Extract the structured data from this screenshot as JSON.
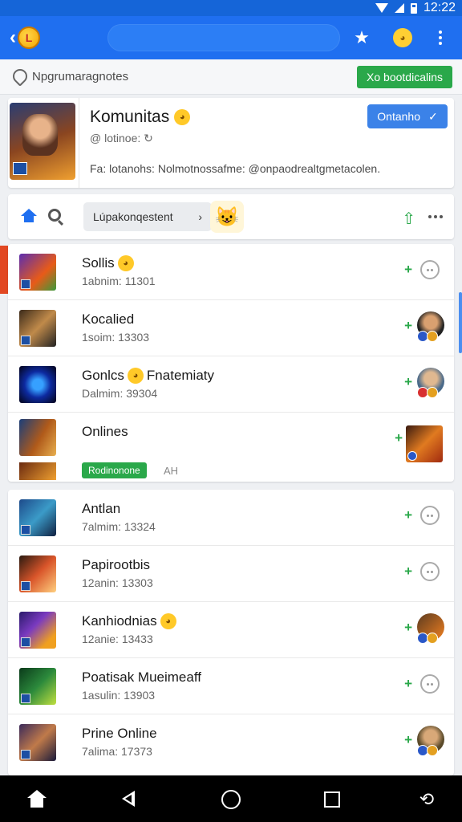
{
  "status_bar": {
    "time": "12:22"
  },
  "appbar": {
    "logo_text": "L"
  },
  "subbar": {
    "text": "Npgrumaragnotes",
    "button": "Xo bootdicalins"
  },
  "profile": {
    "name": "Komunitas",
    "handle": "@ lotinoe:",
    "bio": "Fa: lotanohs: Nolmotnossafme: @onpaodrealtgmetacolen.",
    "status_button": "Ontanho"
  },
  "nav": {
    "breadcrumb": "Lúpakonqestent"
  },
  "list1": [
    {
      "name": "Sollis",
      "sub": "1abnim: 11301",
      "emoji": true,
      "action": "chat"
    },
    {
      "name": "Kocalied",
      "sub": "1soim: 13303",
      "emoji": false,
      "action": "avatar"
    },
    {
      "name": "Gonlcs",
      "name_suffix": "Fnatemiaty",
      "sub": "Dalmim: 39304",
      "emoji": true,
      "action": "avatar"
    },
    {
      "name": "Onlines",
      "pill": "Rodinonone",
      "pill_note": "AH",
      "action": "square"
    }
  ],
  "list2": [
    {
      "name": "Antlan",
      "sub": "7almim: 13324",
      "emoji": false,
      "action": "chat"
    },
    {
      "name": "Papirootbis",
      "sub": "12anin: 13303",
      "emoji": false,
      "action": "chat"
    },
    {
      "name": "Kanhiodnias",
      "sub": "12anie: 13433",
      "emoji": true,
      "action": "avatar"
    },
    {
      "name": "Poatisak Mueimeaff",
      "sub": "1asulin: 13903",
      "emoji": false,
      "action": "chat"
    },
    {
      "name": "Prine Online",
      "sub": "7alima: 17373",
      "emoji": false,
      "action": "avatar"
    }
  ],
  "icons": {
    "back": "chevron-left-icon",
    "star": "star-icon",
    "emoji": "smiley-icon",
    "menu": "more-vertical-icon",
    "upload": "upload-icon",
    "chat": "chat-bubble-icon",
    "plus": "plus-icon"
  },
  "colors": {
    "primary": "#1f6ff0",
    "accent_green": "#2aa84a",
    "alert_red": "#e24822"
  }
}
